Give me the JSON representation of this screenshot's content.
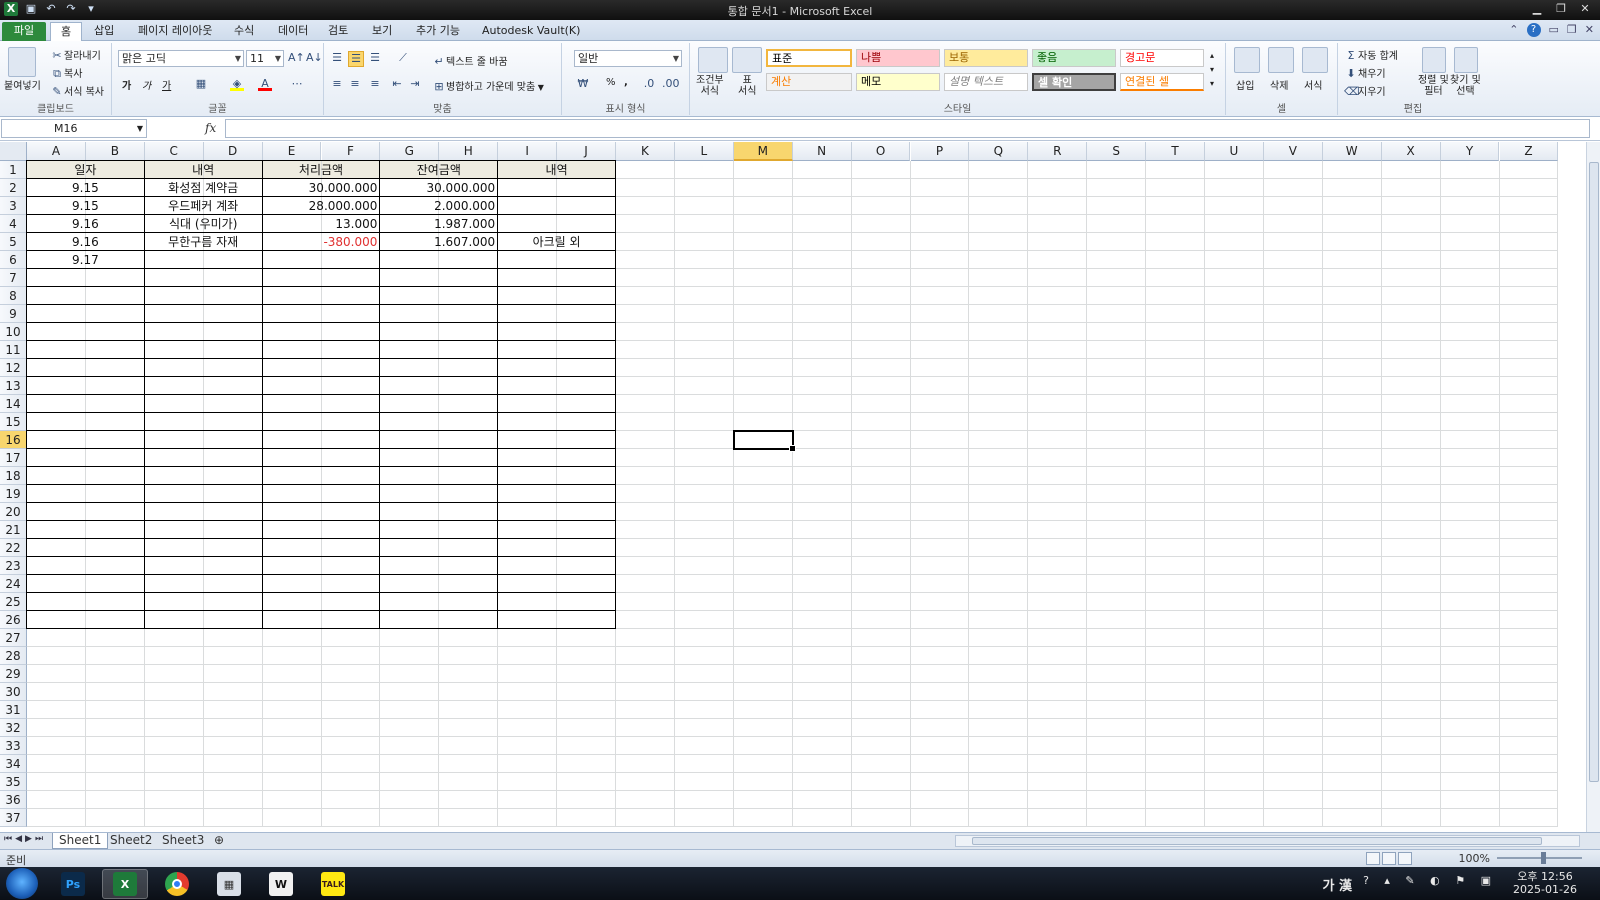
{
  "window": {
    "title": "통합 문서1 - Microsoft Excel"
  },
  "ribbon": {
    "tabs": [
      "파일",
      "홈",
      "삽입",
      "페이지 레이아웃",
      "수식",
      "데이터",
      "검토",
      "보기",
      "추가 기능",
      "Autodesk Vault(K)"
    ],
    "active_tab": "홈",
    "clipboard": {
      "paste": "붙여넣기",
      "cut": "잘라내기",
      "copy": "복사",
      "format_painter": "서식 복사",
      "label": "클립보드"
    },
    "font": {
      "name": "맑은 고딕",
      "size": "11",
      "bold": "가",
      "italic": "가",
      "underline": "가",
      "label": "글꼴"
    },
    "alignment": {
      "wrap_text": "텍스트 줄 바꿈",
      "merge_center": "병합하고 가운데 맞춤",
      "label": "맞춤"
    },
    "number": {
      "format": "일반",
      "percent": "%",
      "comma": ",",
      "label": "표시 형식"
    },
    "styles": {
      "conditional": "조건부\n서식",
      "table_format": "표\n서식",
      "cells": [
        {
          "label": "표준",
          "bg": "#ffffff",
          "fg": "#000000"
        },
        {
          "label": "나쁨",
          "bg": "#ffc7ce",
          "fg": "#9c0006"
        },
        {
          "label": "보통",
          "bg": "#ffeb9c",
          "fg": "#9c6500"
        },
        {
          "label": "좋음",
          "bg": "#c6efce",
          "fg": "#006100"
        },
        {
          "label": "경고문",
          "bg": "#ffffff",
          "fg": "#ff0000"
        },
        {
          "label": "계산",
          "bg": "#f2f2f2",
          "fg": "#fa7d00"
        },
        {
          "label": "메모",
          "bg": "#ffffcc",
          "fg": "#000000"
        },
        {
          "label": "설명 텍스트",
          "bg": "#ffffff",
          "fg": "#7f7f7f"
        },
        {
          "label": "셀 확인",
          "bg": "#a5a5a5",
          "fg": "#ffffff"
        },
        {
          "label": "연결된 셀",
          "bg": "#ffffff",
          "fg": "#fa7d00"
        }
      ],
      "label": "스타일"
    },
    "cells_group": {
      "insert": "삽입",
      "delete": "삭제",
      "format": "서식",
      "label": "셀"
    },
    "editing": {
      "autosum": "자동 합계",
      "fill": "채우기",
      "clear": "지우기",
      "sort_filter": "정렬 및\n필터",
      "find_select": "찾기 및\n선택",
      "label": "편집"
    }
  },
  "formula_bar": {
    "name_box": "M16",
    "fx": "fx",
    "formula": ""
  },
  "sheet": {
    "columns": [
      "A",
      "B",
      "C",
      "D",
      "E",
      "F",
      "G",
      "H",
      "I",
      "J",
      "K",
      "L",
      "M",
      "N",
      "O",
      "P",
      "Q",
      "R",
      "S",
      "T",
      "U",
      "V",
      "W",
      "X",
      "Y",
      "Z"
    ],
    "selected_column": "M",
    "selected_row": 16,
    "rows": 37,
    "header": {
      "date": "일자",
      "desc": "내역",
      "amount": "처리금액",
      "balance": "잔여금액",
      "note": "내역"
    },
    "data": [
      {
        "date": "9.15",
        "desc": "화성점 계약금",
        "amount": "30.000.000",
        "balance": "30.000.000",
        "note": "",
        "negative": false
      },
      {
        "date": "9.15",
        "desc": "우드페커 계좌",
        "amount": "28.000.000",
        "balance": "2.000.000",
        "note": "",
        "negative": false
      },
      {
        "date": "9.16",
        "desc": "식대 (우미가)",
        "amount": "13.000",
        "balance": "1.987.000",
        "note": "",
        "negative": false
      },
      {
        "date": "9.16",
        "desc": "무한구름 자재",
        "amount": "-380.000",
        "balance": "1.607.000",
        "note": "아크릴 외",
        "negative": true
      },
      {
        "date": "9.17",
        "desc": "",
        "amount": "",
        "balance": "",
        "note": "",
        "negative": false
      }
    ]
  },
  "sheet_tabs": [
    "Sheet1",
    "Sheet2",
    "Sheet3"
  ],
  "active_sheet": "Sheet1",
  "status": {
    "mode": "준비",
    "zoom": "100%"
  },
  "taskbar": {
    "apps": [
      {
        "name": "photoshop",
        "label": "Ps",
        "color": "#0b2a4a",
        "fg": "#2fa3ff",
        "running": false
      },
      {
        "name": "excel",
        "label": "X",
        "color": "#1e7a3a",
        "fg": "#ffffff",
        "running": true
      },
      {
        "name": "chrome",
        "label": "",
        "color": "#e33b2e",
        "fg": "#ffffff",
        "running": false
      },
      {
        "name": "calculator",
        "label": "▦",
        "color": "#d9dfe8",
        "fg": "#333333",
        "running": false
      },
      {
        "name": "word24",
        "label": "W",
        "color": "#f1f1f1",
        "fg": "#111111",
        "running": false
      },
      {
        "name": "kakaotalk",
        "label": "TALK",
        "color": "#ffe812",
        "fg": "#3a1d1d",
        "running": false
      }
    ],
    "ime": "가 漢",
    "time": "오후 12:56",
    "date": "2025-01-26"
  }
}
